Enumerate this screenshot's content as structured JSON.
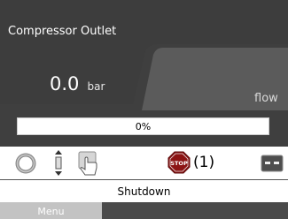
{
  "header": {
    "title": "Compressor Outlet"
  },
  "pressure": {
    "value": "0.0",
    "unit": "bar"
  },
  "flow": {
    "label": "flow"
  },
  "progress": {
    "label": "0%",
    "fraction": 0.0
  },
  "toolbar": {
    "icons": [
      "ring-icon",
      "updown-arrows-icon",
      "hand-pointer-icon",
      "stop-sign-icon",
      "panel-icon"
    ],
    "stop_sign_text": "STOP",
    "stop_count": "(1)"
  },
  "status": {
    "text": "Shutdown"
  },
  "menu": {
    "label": "Menu"
  },
  "colors": {
    "panel": "#4d4d4d",
    "panel_light": "#5a5a5a",
    "stop_red": "#b31d1d",
    "menu_gray": "#c3c3c3"
  }
}
